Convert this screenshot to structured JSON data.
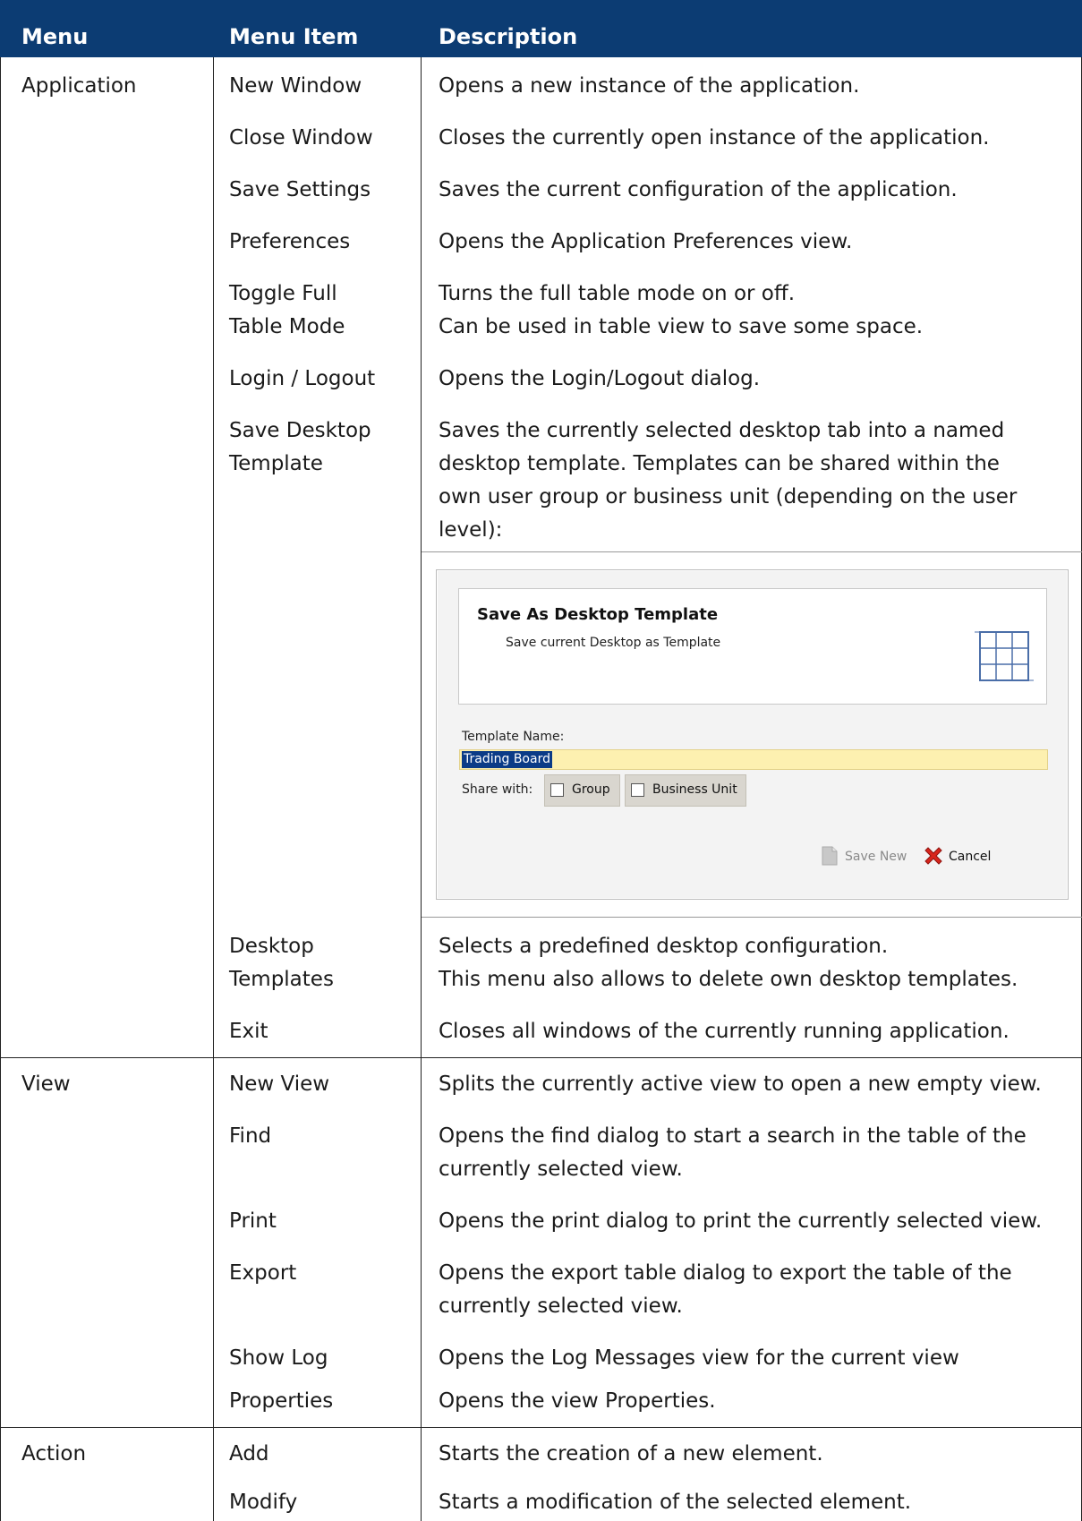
{
  "header": {
    "col_menu": "Menu",
    "col_item": "Menu Item",
    "col_desc": "Description"
  },
  "rows": [
    {
      "menu": "Application",
      "item": [
        "New Window"
      ],
      "desc": [
        "Opens a new instance of the application."
      ]
    },
    {
      "menu": "",
      "item": [
        "Close Window"
      ],
      "desc": [
        "Closes the currently open instance of the application."
      ]
    },
    {
      "menu": "",
      "item": [
        "Save Settings"
      ],
      "desc": [
        "Saves the current configuration of the application."
      ]
    },
    {
      "menu": "",
      "item": [
        "Preferences"
      ],
      "desc": [
        "Opens the Application Preferences view."
      ]
    },
    {
      "menu": "",
      "item": [
        "Toggle Full",
        "Table Mode"
      ],
      "desc": [
        "Turns the full table mode on or off.",
        "Can be used in table view to save some space."
      ]
    },
    {
      "menu": "",
      "item": [
        "Login / Logout"
      ],
      "desc": [
        "Opens the Login/Logout dialog."
      ]
    },
    {
      "menu": "",
      "item": [
        "Save Desktop",
        "Template"
      ],
      "desc": [
        "Saves the currently selected desktop tab into a named",
        "desktop template. Templates can be shared within the",
        "own user group or business unit (depending on the user",
        "level):"
      ]
    },
    {
      "menu": "",
      "item": [
        "Desktop",
        "Templates"
      ],
      "desc": [
        "Selects a predefined desktop configuration.",
        "This menu also allows to delete own desktop templates."
      ]
    },
    {
      "menu": "",
      "item": [
        "Exit"
      ],
      "desc": [
        "Closes all windows of the currently running application."
      ]
    },
    {
      "menu": "View",
      "item": [
        "New View"
      ],
      "desc": [
        "Splits the currently active view to open a new empty view."
      ]
    },
    {
      "menu": "",
      "item": [
        "Find"
      ],
      "desc": [
        "Opens the find dialog to start a search in the table of the",
        "currently selected view."
      ]
    },
    {
      "menu": "",
      "item": [
        "Print"
      ],
      "desc": [
        "Opens the print dialog to print the currently selected view."
      ]
    },
    {
      "menu": "",
      "item": [
        "Export"
      ],
      "desc": [
        "Opens the export table dialog to export the table of the",
        "currently selected view."
      ]
    },
    {
      "menu": "",
      "item": [
        "Show Log"
      ],
      "desc": [
        "Opens the Log Messages view for the current view"
      ]
    },
    {
      "menu": "",
      "item": [
        "Properties"
      ],
      "desc": [
        "Opens the view Properties."
      ]
    },
    {
      "menu": "Action",
      "item": [
        "Add"
      ],
      "desc": [
        "Starts the creation of a new element."
      ]
    },
    {
      "menu": "",
      "item": [
        "Modify"
      ],
      "desc": [
        "Starts a modification of the selected element."
      ]
    }
  ],
  "dialog": {
    "title": "Save As Desktop Template",
    "subtitle": "Save current Desktop as Template",
    "name_label": "Template Name:",
    "name_value": "Trading Board",
    "share_label": "Share with:",
    "group_label": "Group",
    "bu_label": "Business Unit",
    "save_new_label": "Save New",
    "cancel_label": "Cancel"
  },
  "colors": {
    "header_bg": "#0c3c73",
    "input_bg": "#fdf0b0",
    "selection_bg": "#0b3b87"
  }
}
